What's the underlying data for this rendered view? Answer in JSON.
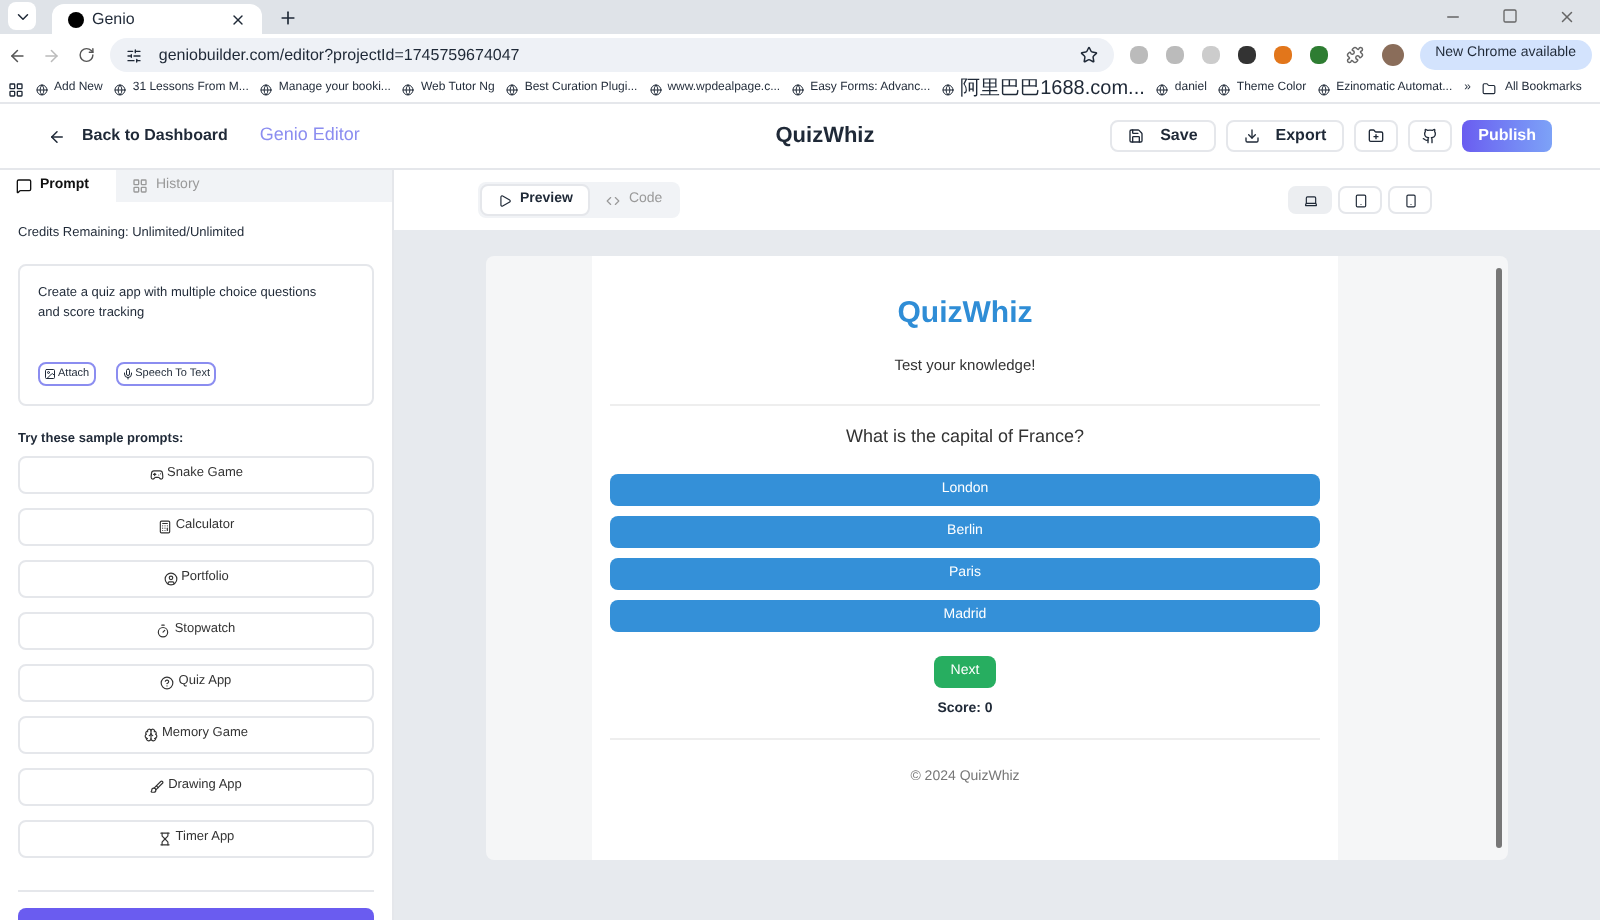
{
  "browser": {
    "tab_title": "Genio",
    "url": "geniobuilder.com/editor?projectId=1745759674047",
    "update_button": "New Chrome available",
    "bookmarks": [
      {
        "label": "Add New"
      },
      {
        "label": "31 Lessons From M..."
      },
      {
        "label": "Manage your booki..."
      },
      {
        "label": "Web Tutor Ng"
      },
      {
        "label": "Best Curation Plugi..."
      },
      {
        "label": "www.wpdealpage.c..."
      },
      {
        "label": "Easy Forms: Advanc..."
      },
      {
        "label": "阿里巴巴1688.com..."
      },
      {
        "label": "daniel"
      },
      {
        "label": "Theme Color"
      },
      {
        "label": "Ezinomatic Automat..."
      }
    ],
    "more": "»",
    "all_bookmarks": "All Bookmarks"
  },
  "header": {
    "back": "Back to Dashboard",
    "brand": "Genio Editor",
    "project_title": "QuizWhiz",
    "save": "Save",
    "export": "Export",
    "publish": "Publish"
  },
  "sidebar": {
    "tabs": [
      {
        "label": "Prompt",
        "selected": true
      },
      {
        "label": "History",
        "selected": false
      }
    ],
    "credits": "Credits Remaining: Unlimited/Unlimited",
    "prompt_text": "Create a quiz app with multiple choice questions and score tracking",
    "attach": "Attach",
    "speech": "Speech To Text",
    "samples_heading": "Try these sample prompts:",
    "samples": [
      {
        "kind": "gamepad",
        "label": "Snake Game"
      },
      {
        "kind": "calculator",
        "label": "Calculator"
      },
      {
        "kind": "user",
        "label": "Portfolio"
      },
      {
        "kind": "stopwatch",
        "label": "Stopwatch"
      },
      {
        "kind": "question",
        "label": "Quiz App"
      },
      {
        "kind": "brain",
        "label": "Memory Game"
      },
      {
        "kind": "brush",
        "label": "Drawing App"
      },
      {
        "kind": "hourglass",
        "label": "Timer App"
      }
    ]
  },
  "preview": {
    "view_tabs": [
      {
        "label": "Preview",
        "selected": true
      },
      {
        "label": "Code",
        "selected": false
      }
    ],
    "devices": [
      {
        "kind": "laptop",
        "selected": true
      },
      {
        "kind": "tablet",
        "selected": false
      },
      {
        "kind": "phone",
        "selected": false
      }
    ],
    "app": {
      "title": "QuizWhiz",
      "subtitle": "Test your knowledge!",
      "question": "What is the capital of France?",
      "options": [
        "London",
        "Berlin",
        "Paris",
        "Madrid"
      ],
      "next": "Next",
      "score": "Score: 0",
      "footer": "© 2024 QuizWhiz"
    }
  }
}
